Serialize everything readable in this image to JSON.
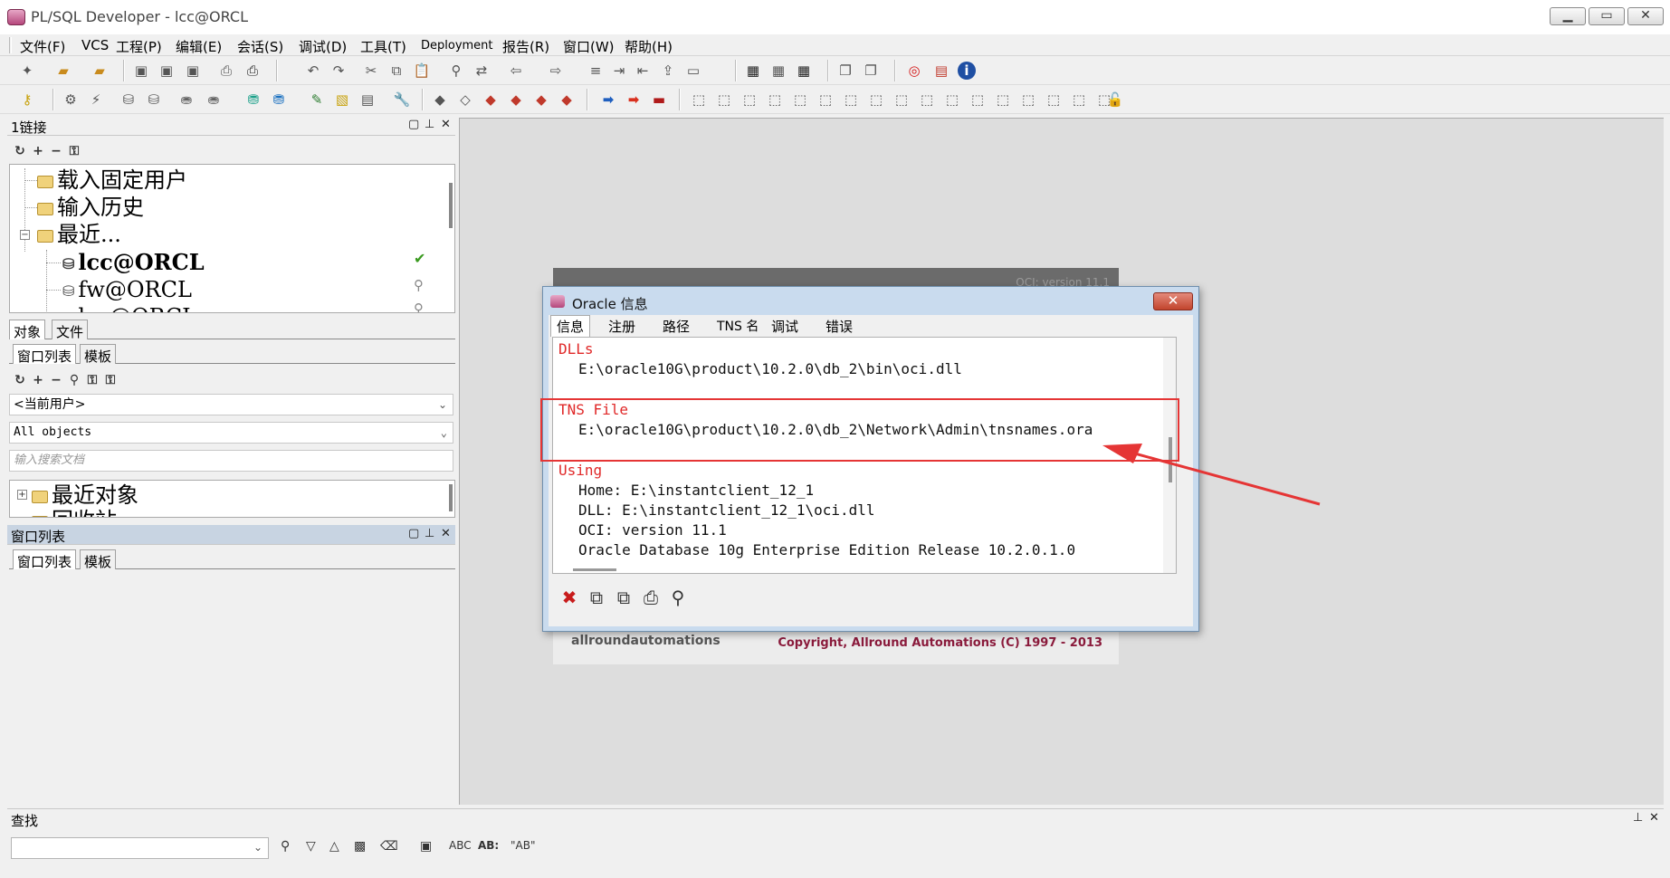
{
  "window": {
    "title": "PL/SQL Developer - lcc@ORCL",
    "minimize_icon": "minimize-icon",
    "maximize_icon": "maximize-icon",
    "close_icon": "close-icon"
  },
  "menu": [
    "文件(F)",
    "VCS",
    "工程(P)",
    "编辑(E)",
    "会话(S)",
    "调试(D)",
    "工具(T)",
    "Deployment",
    "报告(R)",
    "窗口(W)",
    "帮助(H)"
  ],
  "connections_panel": {
    "title": "1链接",
    "tools": [
      "↻",
      "+",
      "−",
      "⚿"
    ],
    "tree": [
      {
        "label": "载入固定用户",
        "type": "folder"
      },
      {
        "label": "输入历史",
        "type": "folder"
      },
      {
        "label": "最近...",
        "type": "folder",
        "expanded": true
      },
      {
        "label": "lcc@ORCL",
        "type": "db",
        "bold": true
      },
      {
        "label": "fw@ORCL",
        "type": "db"
      },
      {
        "label": "lcc@ORCL",
        "type": "db",
        "partial": true
      }
    ]
  },
  "object_tabs": [
    "对象",
    "文件"
  ],
  "window_list_tabs": [
    "窗口列表",
    "模板"
  ],
  "object_tools": [
    "↻",
    "+",
    "−",
    "⚲",
    "⚿",
    "⚿"
  ],
  "user_combo": "<当前用户>",
  "objects_combo": "All objects",
  "search_placeholder": "输入搜索文档",
  "object_tree": [
    "最近对象",
    "回收站"
  ],
  "window_list_panel": {
    "title": "窗口列表",
    "tabs": [
      "窗口列表",
      "模板"
    ]
  },
  "splash": {
    "oci": "OCI: version 11.1",
    "logo": "allroundautomations",
    "copyright": "Copyright, Allround Automations (C) 1997 - 2013"
  },
  "dialog": {
    "title": "Oracle 信息",
    "tabs": [
      "信息",
      "注册",
      "路径",
      "TNS 名",
      "调试",
      "错误"
    ],
    "sections": [
      {
        "heading": "DLLs",
        "lines": [
          "E:\\oracle10G\\product\\10.2.0\\db_2\\bin\\oci.dll"
        ]
      },
      {
        "heading": "TNS File",
        "lines": [
          "E:\\oracle10G\\product\\10.2.0\\db_2\\Network\\Admin\\tnsnames.ora"
        ]
      },
      {
        "heading": "Using",
        "lines": [
          "Home: E:\\instantclient_12_1",
          "DLL: E:\\instantclient_12_1\\oci.dll",
          "OCI: version 11.1",
          "Oracle Database 10g Enterprise Edition Release 10.2.0.1.0"
        ]
      }
    ],
    "close_label": "✕"
  },
  "find": {
    "title": "查找",
    "abc_label": "ABC",
    "ab_label": "AB:",
    "quote_label": "\"AB\""
  },
  "colors": {
    "annotation": "#e53535",
    "heading_red": "#e02828"
  }
}
